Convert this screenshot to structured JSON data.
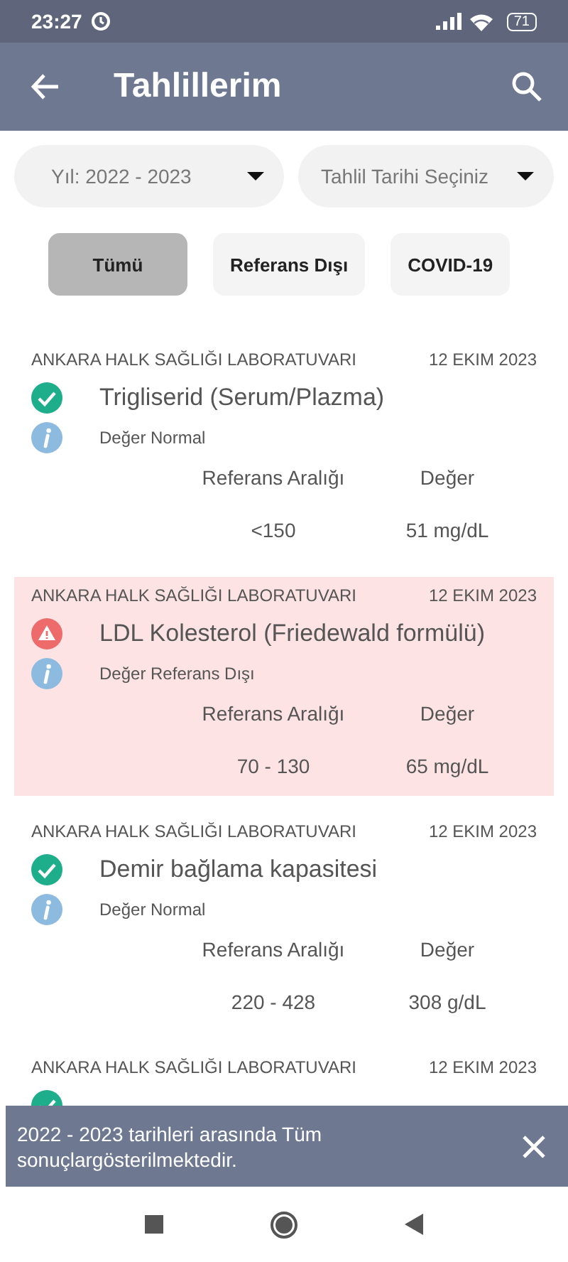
{
  "status_bar": {
    "time": "23:27",
    "battery": "71"
  },
  "app_bar": {
    "title": "Tahlillerim"
  },
  "filters": [
    {
      "label": "Yıl: 2022 - 2023"
    },
    {
      "label": "Tahlil Tarihi Seçiniz"
    }
  ],
  "chips": [
    {
      "label": "Tümü",
      "selected": true
    },
    {
      "label": "Referans Dışı",
      "selected": false
    },
    {
      "label": "COVID-19",
      "selected": false
    }
  ],
  "results": [
    {
      "lab": "ANKARA HALK SAĞLIĞI LABORATUVARI",
      "date": "12 EKIM 2023",
      "kind": "normal",
      "name": "Trigliserid (Serum/Plazma)",
      "status_text": "Değer Normal",
      "reference_header": "Referans Aralığı",
      "value_header": "Değer",
      "reference": "<150",
      "value": "51 mg/dL"
    },
    {
      "lab": "ANKARA HALK SAĞLIĞI LABORATUVARI",
      "date": "12 EKIM 2023",
      "kind": "out_of_range",
      "name": "LDL Kolesterol (Friedewald formülü)",
      "status_text": "Değer Referans Dışı",
      "reference_header": "Referans Aralığı",
      "value_header": "Değer",
      "reference": "70 - 130",
      "value": "65 mg/dL"
    },
    {
      "lab": "ANKARA HALK SAĞLIĞI LABORATUVARI",
      "date": "12 EKIM 2023",
      "kind": "normal",
      "name": "Demir bağlama kapasitesi",
      "status_text": "Değer Normal",
      "reference_header": "Referans Aralığı",
      "value_header": "Değer",
      "reference": "220 - 428",
      "value": "308 g/dL"
    },
    {
      "lab": "ANKARA HALK SAĞLIĞI LABORATUVARI",
      "date": "12 EKIM 2023",
      "kind": "normal"
    }
  ],
  "snackbar": {
    "message": "2022 - 2023 tarihleri arasında Tüm sonuçlargösterilmektedir."
  }
}
